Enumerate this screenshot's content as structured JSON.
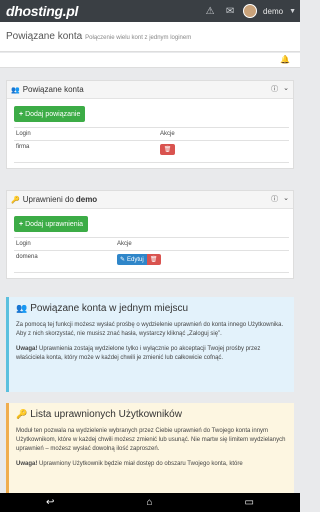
{
  "topbar": {
    "logo": "dhosting.pl",
    "user": "demo",
    "icons": [
      "warning-icon",
      "mail-icon",
      "avatar",
      "chevron-down-icon"
    ]
  },
  "header": {
    "title": "Powiązane konta",
    "subtitle": "Połączenie wielu kont z jednym loginem"
  },
  "linked_accounts": {
    "title": "Powiązane konta",
    "add_label": "Dodaj powiązanie",
    "columns": [
      "Login",
      "Akcje"
    ],
    "rows": [
      {
        "login": "firma"
      }
    ]
  },
  "permissions": {
    "title_prefix": "Uprawnieni do",
    "title_user": "demo",
    "add_label": "Dodaj uprawnienia",
    "columns": [
      "Login",
      "Akcje"
    ],
    "rows": [
      {
        "login": "domena",
        "edit_label": "Edytuj"
      }
    ]
  },
  "info1": {
    "title": "Powiązane konta w jednym miejscu",
    "p1": "Za pomocą tej funkcji możesz wysłać prośbę o wydzielenie uprawnień do konta innego Użytkownika. Aby z nich skorzystać, nie musisz znać hasła, wystarczy kliknąć „Zaloguj się”.",
    "p2_bold": "Uwaga!",
    "p2": " Uprawnienia zostają wydzielone tylko i wyłącznie po akceptacji Twojej prośby przez właściciela konta, który może w każdej chwili je zmienić lub całkowicie cofnąć."
  },
  "info2": {
    "title": "Lista uprawnionych Użytkowników",
    "p1": "Moduł ten pozwala na wydzielenie wybranych przez Ciebie uprawnień do Twojego konta innym Użytkownikom, które w każdej chwili możesz zmienić lub usunąć. Nie martw się limitem wydzielanych uprawnień – możesz wysłać dowolną ilość zaproszeń.",
    "p2_bold": "Uwaga!",
    "p2": " Uprawniony Użytkownik będzie miał dostęp do obszaru Twojego konta, które"
  }
}
